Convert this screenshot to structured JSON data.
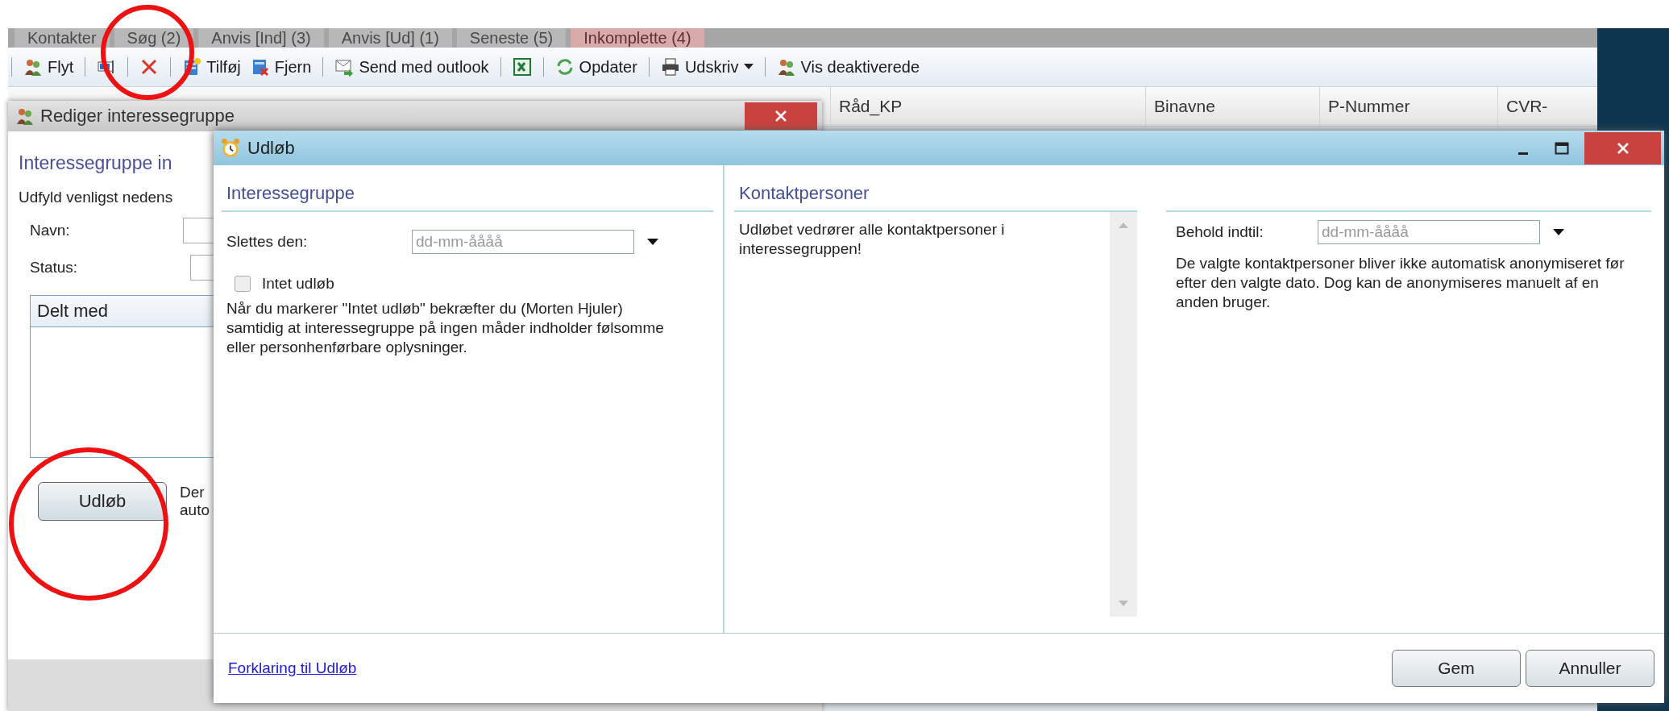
{
  "tabs": [
    {
      "label": "Kontakter",
      "selected": false
    },
    {
      "label": "Søg (2)",
      "selected": false
    },
    {
      "label": "Anvis [Ind] (3)",
      "selected": false
    },
    {
      "label": "Anvis [Ud] (1)",
      "selected": false
    },
    {
      "label": "Seneste (5)",
      "selected": false
    },
    {
      "label": "Inkomplette (4)",
      "selected": true
    }
  ],
  "toolbar": [
    {
      "kind": "separator"
    },
    {
      "kind": "button",
      "label": "Flyt"
    },
    {
      "kind": "separator"
    },
    {
      "kind": "icon-button"
    },
    {
      "kind": "separator"
    },
    {
      "kind": "icon-button"
    },
    {
      "kind": "separator"
    },
    {
      "kind": "button",
      "label": "Tilføj"
    },
    {
      "kind": "button",
      "label": "Fjern"
    },
    {
      "kind": "separator"
    },
    {
      "kind": "button",
      "label": "Send med outlook"
    },
    {
      "kind": "separator"
    },
    {
      "kind": "icon-button"
    },
    {
      "kind": "separator"
    },
    {
      "kind": "button",
      "label": "Opdater"
    },
    {
      "kind": "separator"
    },
    {
      "kind": "dropdown",
      "label": "Udskriv"
    },
    {
      "kind": "separator"
    },
    {
      "kind": "button",
      "label": "Vis deaktiverede"
    }
  ],
  "grid": {
    "columns": [
      "Råd_KP",
      "Binavne",
      "P-Nummer",
      "CVR-"
    ]
  },
  "edit_dialog": {
    "title": "Rediger interessegruppe",
    "heading": "Interessegruppe in",
    "intro": "Udfyld venligst nedens",
    "fields": [
      {
        "label": "Navn:"
      },
      {
        "label": "Status:"
      }
    ],
    "shared_list": {
      "header": "Delt med"
    },
    "expiry_button": "Udløb",
    "note_lines": [
      "Der",
      "auto"
    ]
  },
  "expiry_dialog": {
    "title": "Udløb",
    "group_section": {
      "heading": "Interessegruppe",
      "field": {
        "label": "Slettes den:",
        "placeholder": "dd-mm-åååå"
      },
      "checkbox": {
        "label": "Intet udløb",
        "checked": false
      },
      "text": "Når du markerer \"Intet udløb\" bekræfter du (Morten Hjuler) samtidig at interessegruppe på ingen måder indholder følsomme eller personhenførbare oplysninger."
    },
    "contacts_section": {
      "heading": "Kontaktpersoner",
      "list_text": "Udløbet vedrører alle kontaktpersoner i interessegruppen!",
      "field": {
        "label": "Behold indtil:",
        "placeholder": "dd-mm-åååå"
      },
      "text": "De valgte kontaktpersoner bliver ikke automatisk anonymiseret før efter den valgte dato. Dog kan de anonymiseres manuelt af en anden bruger."
    },
    "footer": {
      "link": "Forklaring til Udløb",
      "buttons": [
        "Gem",
        "Annuller"
      ]
    }
  }
}
